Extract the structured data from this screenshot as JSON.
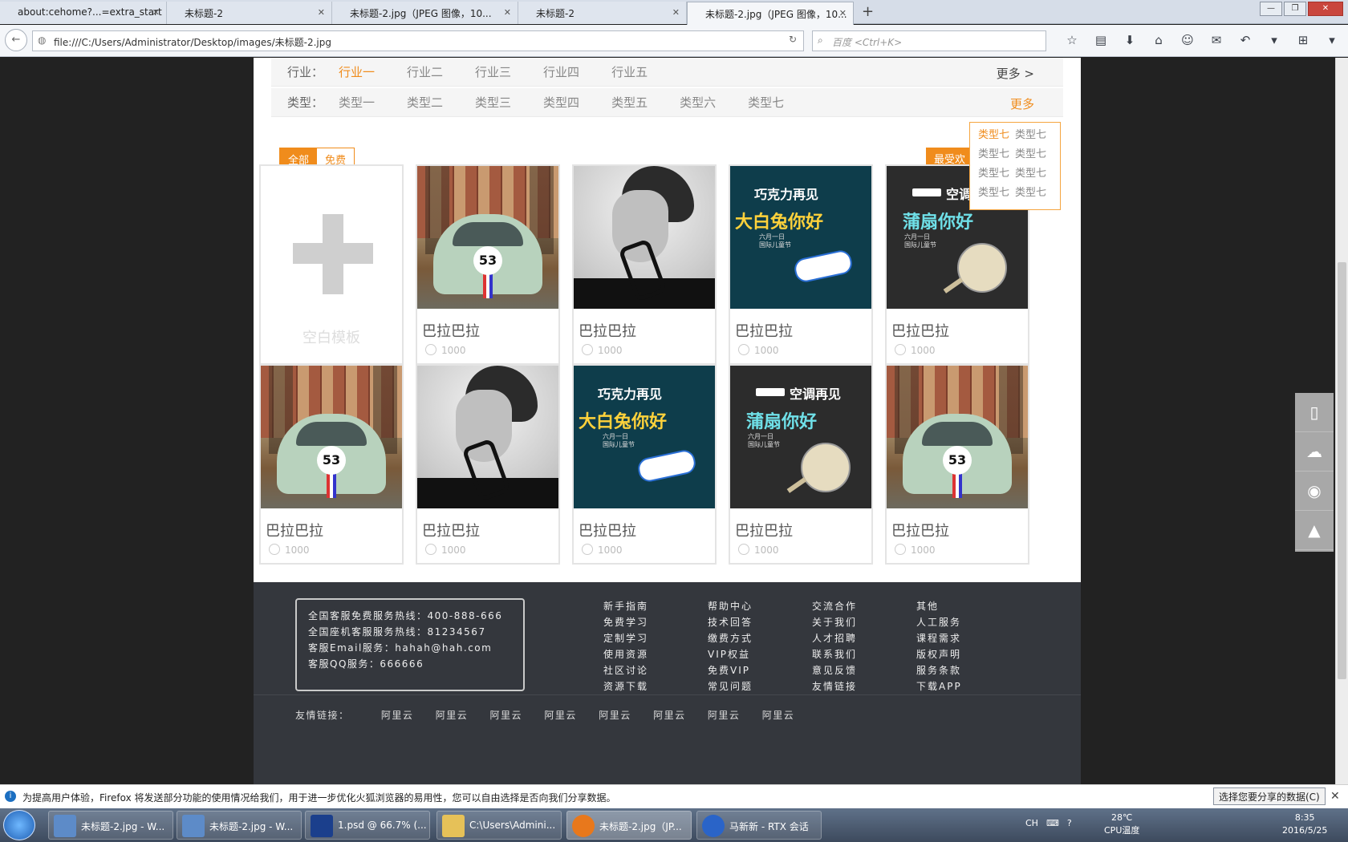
{
  "browser": {
    "tabs": [
      {
        "label": "about:cehome?...=extra_start"
      },
      {
        "label": "未标题-2"
      },
      {
        "label": "未标题-2.jpg（JPEG 图像，10..."
      },
      {
        "label": "未标题-2"
      },
      {
        "label": "未标题-2.jpg（JPEG 图像，10..."
      }
    ],
    "new_tab": "+",
    "url": "file:///C:/Users/Administrator/Desktop/images/未标题-2.jpg",
    "search_placeholder": "百度 <Ctrl+K>"
  },
  "filters": {
    "industry": {
      "label": "行业：",
      "options": [
        "行业一",
        "行业二",
        "行业三",
        "行业四",
        "行业五"
      ],
      "active_index": 0,
      "more": "更多 >"
    },
    "type": {
      "label": "类型：",
      "options": [
        "类型一",
        "类型二",
        "类型三",
        "类型四",
        "类型五",
        "类型六",
        "类型七"
      ],
      "more": "更多"
    },
    "dropdown": [
      "类型七",
      "类型七",
      "类型七",
      "类型七",
      "类型七",
      "类型七",
      "类型七",
      "类型七"
    ]
  },
  "toolbar": {
    "all": "全部",
    "free": "免费",
    "sort": "最受欢"
  },
  "blank_card": {
    "label": "空白模板"
  },
  "cards": [
    {
      "image": "car-photo",
      "title": "巴拉巴拉",
      "views": "1000"
    },
    {
      "image": "man-photo",
      "title": "巴拉巴拉",
      "views": "1000"
    },
    {
      "image": "candy-poster",
      "title": "巴拉巴拉",
      "views": "1000"
    },
    {
      "image": "fan-poster",
      "title": "巴拉巴拉",
      "views": "1000"
    },
    {
      "image": "car-photo",
      "title": "巴拉巴拉",
      "views": "1000"
    },
    {
      "image": "man-photo",
      "title": "巴拉巴拉",
      "views": "1000"
    },
    {
      "image": "candy-poster",
      "title": "巴拉巴拉",
      "views": "1000"
    },
    {
      "image": "fan-poster",
      "title": "巴拉巴拉",
      "views": "1000"
    },
    {
      "image": "car-photo",
      "title": "巴拉巴拉",
      "views": "1000"
    }
  ],
  "posters": {
    "candy": {
      "line1": "巧克力再见",
      "line2": "大白兔你好",
      "line3a": "六月一日",
      "line3b": "国际儿童节"
    },
    "fan": {
      "line1": "空调再见",
      "line2": "蒲扇你好",
      "line3a": "六月一日",
      "line3b": "国际儿童节"
    },
    "car_badge": "53"
  },
  "footer": {
    "contact": [
      "全国客服免费服务热线：400-888-666",
      "全国座机客服服务热线：81234567",
      "客服Email服务：hahah@hah.com",
      "客服QQ服务：666666"
    ],
    "columns": [
      [
        "新手指南",
        "免费学习",
        "定制学习",
        "使用资源",
        "社区讨论",
        "资源下载"
      ],
      [
        "帮助中心",
        "技术回答",
        "缴费方式",
        "VIP权益",
        "免费VIP",
        "常见问题"
      ],
      [
        "交流合作",
        "关于我们",
        "人才招聘",
        "联系我们",
        "意见反馈",
        "友情链接"
      ],
      [
        "其他",
        "人工服务",
        "课程需求",
        "版权声明",
        "服务条款",
        "下载APP"
      ]
    ],
    "friend_label": "友情链接：",
    "friend_links": [
      "阿里云",
      "阿里云",
      "阿里云",
      "阿里云",
      "阿里云",
      "阿里云",
      "阿里云",
      "阿里云"
    ]
  },
  "notice": {
    "text": "为提高用户体验，Firefox 将发送部分功能的使用情况给我们，用于进一步优化火狐浏览器的易用性，您可以自由选择是否向我们分享数据。",
    "button": "选择您要分享的数据(C)"
  },
  "taskbar": {
    "tasks": [
      "未标题-2.jpg - W...",
      "未标题-2.jpg - W...",
      "1.psd @ 66.7% (...",
      "C:\\Users\\Admini...",
      "未标题-2.jpg（JP...",
      "马新新 - RTX 会话"
    ],
    "lang": "CH",
    "temp": "28℃",
    "temp_label": "CPU温度",
    "time": "8:35",
    "date": "2016/5/25"
  }
}
